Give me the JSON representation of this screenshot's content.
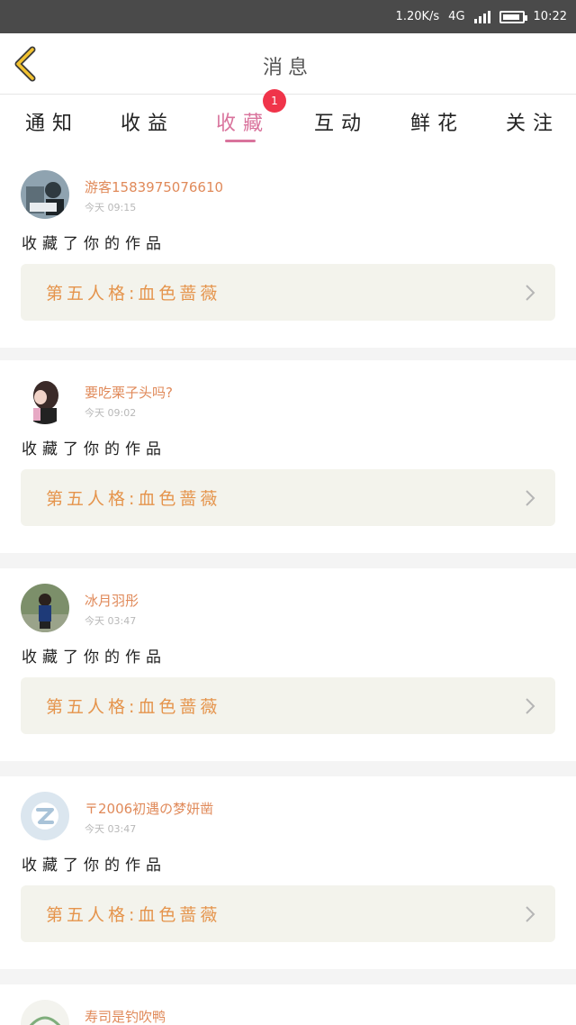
{
  "status_bar": {
    "network_speed": "1.20K/s",
    "network_type": "4G",
    "time": "10:22"
  },
  "header": {
    "title": "消息"
  },
  "tabs": [
    {
      "label": "通知"
    },
    {
      "label": "收益"
    },
    {
      "label": "收藏",
      "active": true,
      "badge": "1"
    },
    {
      "label": "互动"
    },
    {
      "label": "鲜花"
    },
    {
      "label": "关注"
    }
  ],
  "items": [
    {
      "username": "游客1583975076610",
      "time": "今天 09:15",
      "action": "收藏了你的作品",
      "work_title": "第五人格:血色蔷薇"
    },
    {
      "username": "要吃栗子头吗?",
      "time": "今天 09:02",
      "action": "收藏了你的作品",
      "work_title": "第五人格:血色蔷薇"
    },
    {
      "username": "冰月羽彤",
      "time": "今天 03:47",
      "action": "收藏了你的作品",
      "work_title": "第五人格:血色蔷薇"
    },
    {
      "username": "〒2006初遇の梦妍凿",
      "time": "今天 03:47",
      "action": "收藏了你的作品",
      "work_title": "第五人格:血色蔷薇"
    },
    {
      "username": "寿司是钓吹鸭"
    }
  ],
  "colors": {
    "accent": "#d9739c",
    "username": "#e08a5a",
    "work_title": "#e5944c",
    "badge": "#f0344a"
  }
}
